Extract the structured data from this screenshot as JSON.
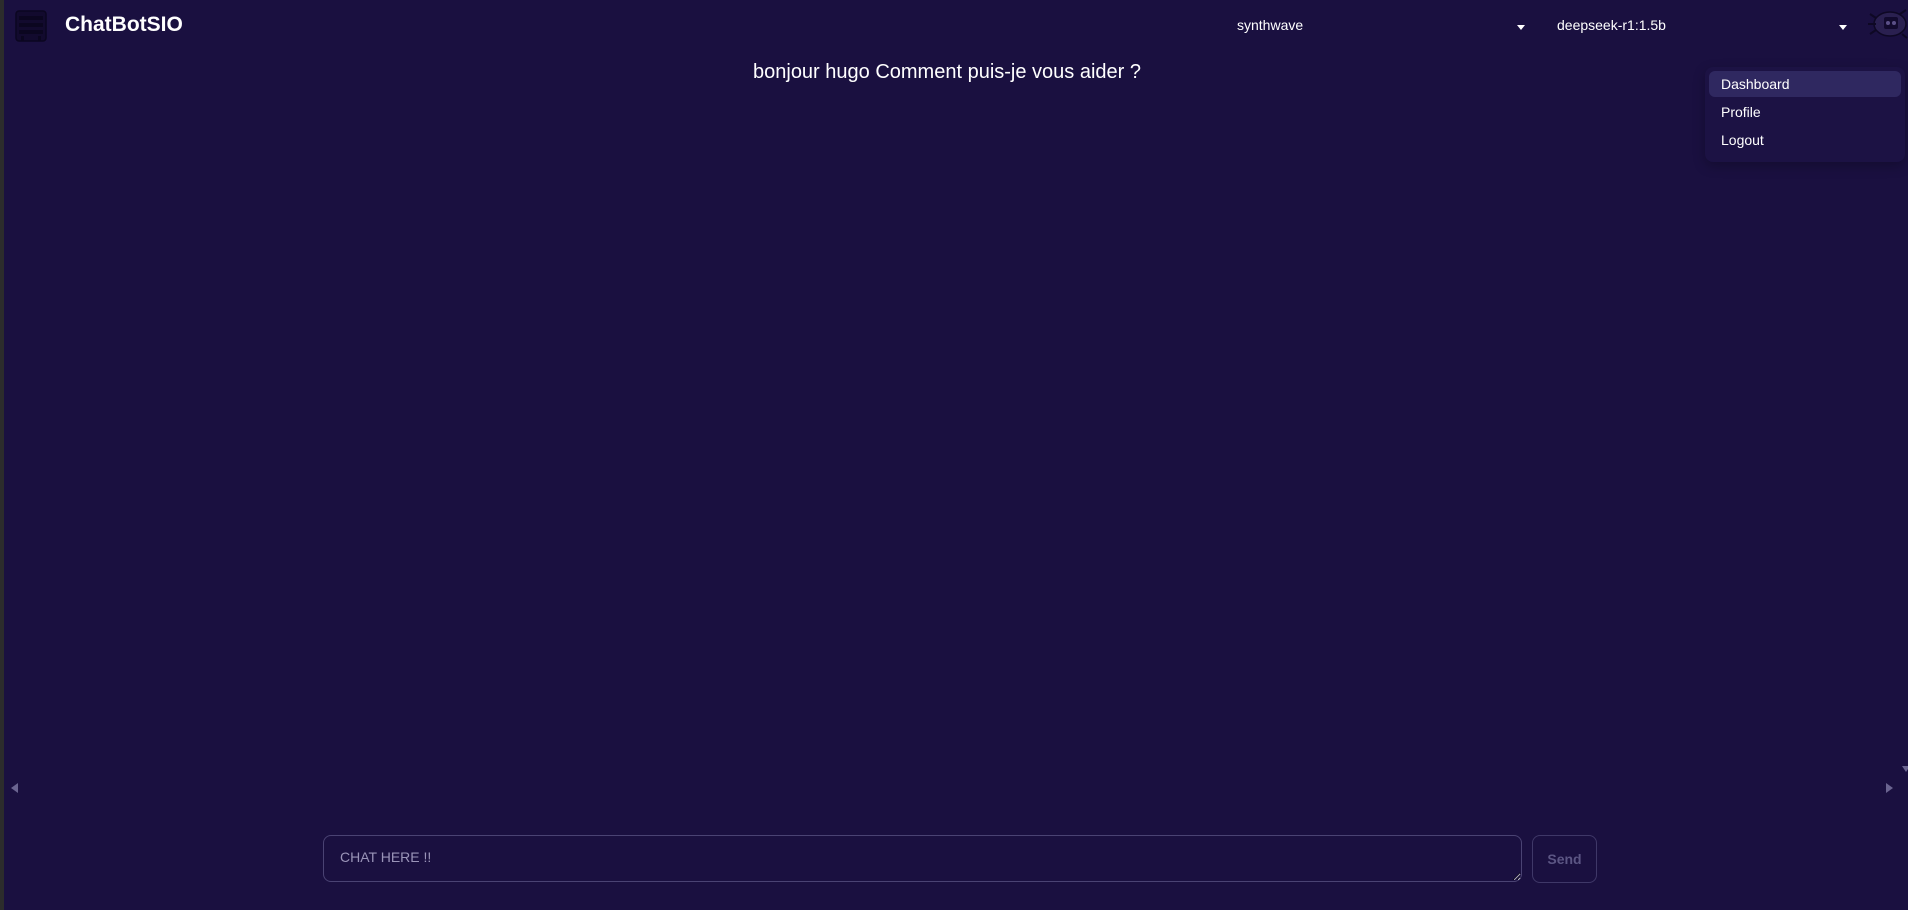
{
  "header": {
    "brand": "ChatBotSIO",
    "logo_icon": "robot-logo-icon",
    "theme_select": {
      "value": "synthwave"
    },
    "model_select": {
      "value": "deepseek-r1:1.5b"
    },
    "avatar_icon": "avatar-icon"
  },
  "chat": {
    "greeting": "bonjour hugo Comment puis-je vous aider ?",
    "input_placeholder": "CHAT HERE !!",
    "send_label": "Send"
  },
  "user_menu": {
    "items": [
      {
        "label": "Dashboard",
        "active": true
      },
      {
        "label": "Profile"
      },
      {
        "label": "Logout"
      }
    ]
  },
  "colors": {
    "background": "#1a1040",
    "menu_active": "#2f2860",
    "input_border": "#4a4373"
  }
}
